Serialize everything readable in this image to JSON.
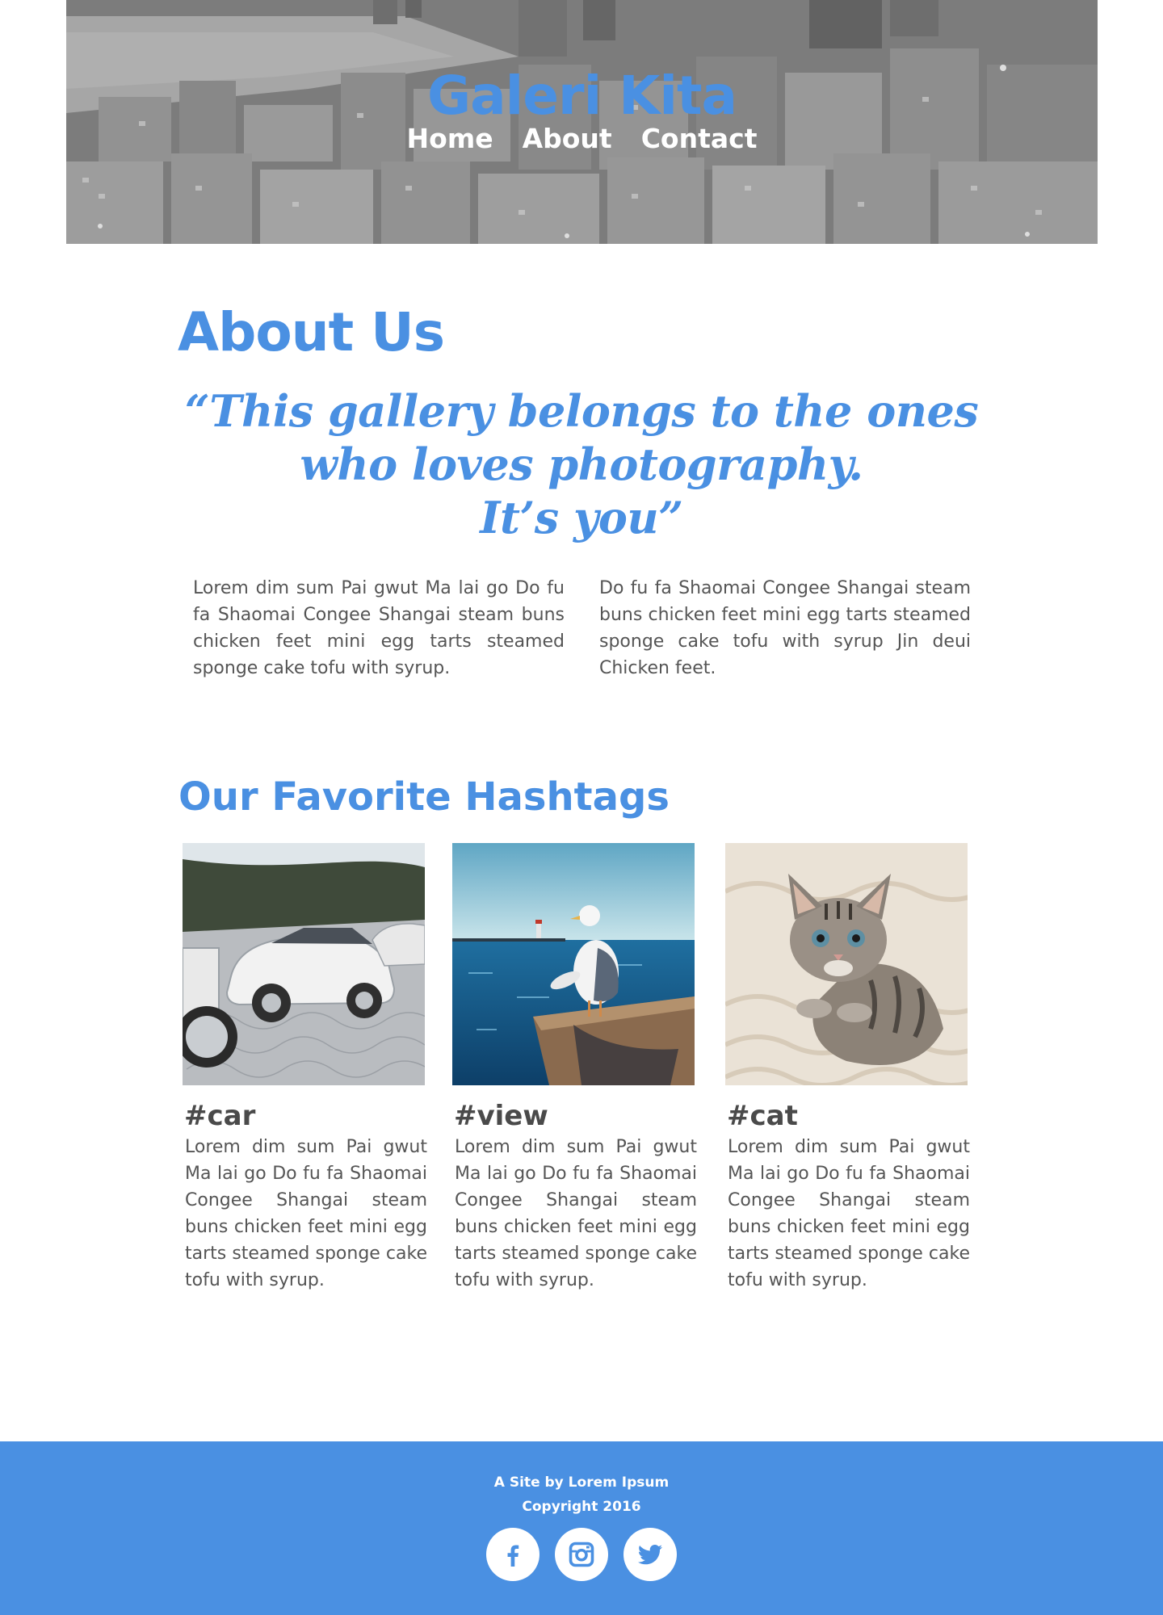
{
  "header": {
    "title": "Galeri Kita",
    "nav": [
      {
        "label": "Home"
      },
      {
        "label": "About"
      },
      {
        "label": "Contact"
      }
    ]
  },
  "about": {
    "heading": "About Us",
    "quote_lines": [
      "“This gallery belongs to the ones",
      "who loves photography.",
      "It’s you”"
    ],
    "paragraphs": [
      "Lorem dim sum Pai gwut Ma lai go Do fu fa Shaomai Congee Shangai steam buns chicken feet mini egg tarts steamed sponge cake tofu with syrup.",
      "Do fu fa Shaomai Congee Shangai steam buns chicken feet mini egg tarts steamed sponge cake tofu with syrup Jin deui Chicken feet."
    ]
  },
  "hashtags": {
    "heading": "Our Favorite Hashtags",
    "cards": [
      {
        "tag": "#car",
        "text": "Lorem dim sum Pai gwut Ma lai go Do fu fa Shaomai Congee Shangai steam buns chicken feet mini egg tarts steamed sponge cake tofu with syrup."
      },
      {
        "tag": "#view",
        "text": "Lorem dim sum Pai gwut Ma lai go Do fu fa Shaomai Congee Shangai steam buns chicken feet mini egg tarts steamed sponge cake tofu with syrup."
      },
      {
        "tag": "#cat",
        "text": "Lorem dim sum Pai gwut Ma lai go Do fu fa Shaomai Congee Shangai steam buns chicken feet mini egg tarts steamed sponge cake tofu with syrup."
      }
    ]
  },
  "footer": {
    "line1": "A Site by Lorem Ipsum",
    "line2": "Copyright 2016",
    "social": [
      {
        "icon": "facebook-icon"
      },
      {
        "icon": "instagram-icon"
      },
      {
        "icon": "twitter-icon"
      }
    ]
  },
  "colors": {
    "accent": "#4a90e2",
    "text": "#555555",
    "tag_text": "#4a4a4a",
    "footer_bg": "#4a90e2"
  }
}
